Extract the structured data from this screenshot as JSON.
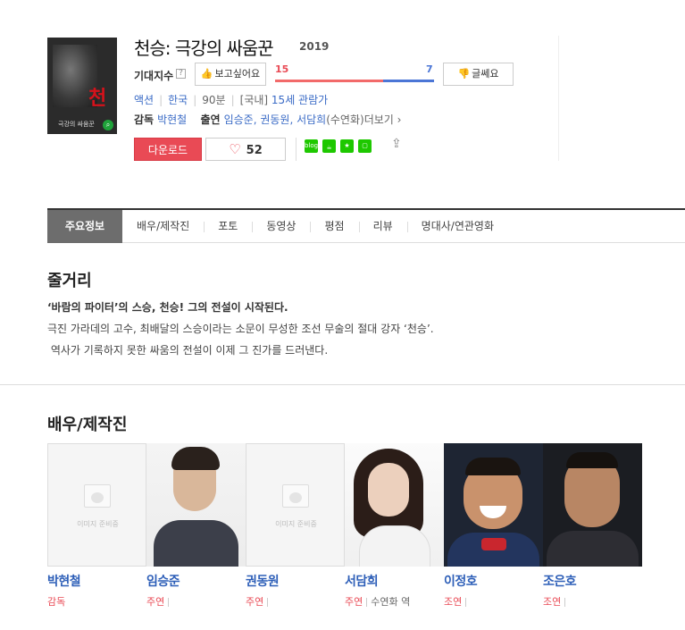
{
  "movie": {
    "title": "천승: 극강의 싸움꾼",
    "year": "2019",
    "poster_big_text": "천승",
    "poster_sub_text": "극강의 싸움꾼"
  },
  "expectation": {
    "label": "기대지수",
    "help": "?",
    "like_label": "보고싶어요",
    "dislike_label": "글쎄요",
    "like_count": "15",
    "dislike_count": "7",
    "like_ratio": 0.68
  },
  "meta": {
    "genre": "액션",
    "country": "한국",
    "runtime": "90분",
    "rating_prefix": "[국내]",
    "rating": "15세 관람가"
  },
  "crew": {
    "director_label": "감독",
    "director": "박현철",
    "cast_label": "출연",
    "cast_names": "임승준, 권동원, 서담희",
    "cast_note": "(수연화)",
    "more": "더보기"
  },
  "actions": {
    "download": "다운로드",
    "heart_count": "52",
    "share_icons": [
      "blog-icon",
      "cafe-icon",
      "star-icon",
      "bookmark-icon"
    ]
  },
  "tabs": [
    {
      "label": "주요정보",
      "active": true
    },
    {
      "label": "배우/제작진"
    },
    {
      "label": "포토"
    },
    {
      "label": "동영상"
    },
    {
      "label": "평점"
    },
    {
      "label": "리뷰"
    },
    {
      "label": "명대사/연관영화"
    }
  ],
  "plot": {
    "heading": "줄거리",
    "tagline": "‘바람의 파이터’의 스승, 천승! 그의 전설이 시작된다.",
    "line1": "극진 가라데의 고수, 최배달의 스승이라는 소문이 무성한 조선 무술의 절대 강자 ‘천승’.",
    "line2": "역사가 기록하지 못한 싸움의 전설이 이제 그 진가를 드러낸다."
  },
  "cast_section": {
    "heading": "배우/제작진",
    "no_image_text": "이미지 준비중",
    "people": [
      {
        "name": "박현철",
        "role": "감독",
        "photo": "none"
      },
      {
        "name": "임승준",
        "role": "주연",
        "photo": "photo"
      },
      {
        "name": "권동원",
        "role": "주연",
        "photo": "none"
      },
      {
        "name": "서담희",
        "role": "주연",
        "as": "수연화 역",
        "photo": "photo"
      },
      {
        "name": "이정호",
        "role": "조연",
        "photo": "photo"
      },
      {
        "name": "조은호",
        "role": "조연",
        "photo": "photo"
      }
    ]
  },
  "colors": {
    "accent_red": "#e94a55",
    "accent_blue": "#4b76d6",
    "link_blue": "#2e5fb8"
  }
}
